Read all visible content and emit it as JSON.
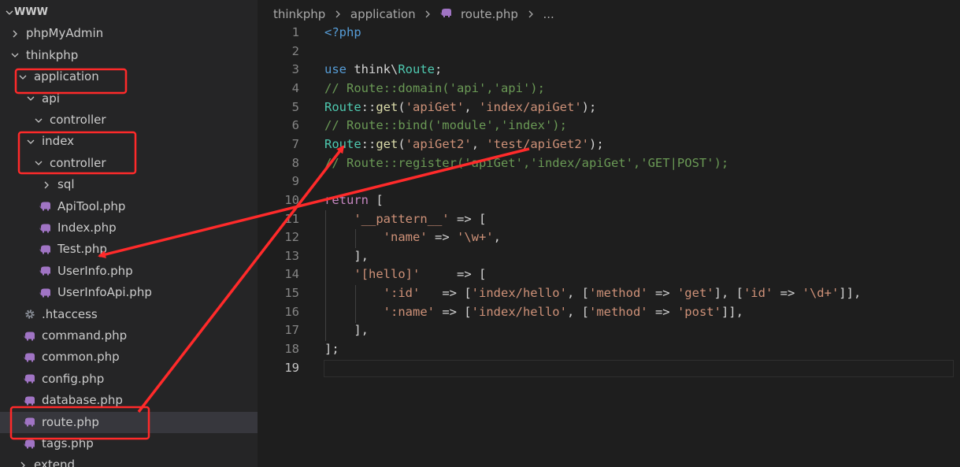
{
  "explorer": {
    "rows": [
      {
        "label": "WWW",
        "depth": 0,
        "chevron": "down",
        "icon": "",
        "root": true
      },
      {
        "label": "phpMyAdmin",
        "depth": 1,
        "chevron": "right",
        "icon": ""
      },
      {
        "label": "thinkphp",
        "depth": 1,
        "chevron": "down",
        "icon": ""
      },
      {
        "label": "application",
        "depth": 2,
        "chevron": "down",
        "icon": ""
      },
      {
        "label": "api",
        "depth": 3,
        "chevron": "down",
        "icon": ""
      },
      {
        "label": "controller",
        "depth": 4,
        "chevron": "down",
        "icon": ""
      },
      {
        "label": "index",
        "depth": 3,
        "chevron": "down",
        "icon": ""
      },
      {
        "label": "controller",
        "depth": 4,
        "chevron": "down",
        "icon": ""
      },
      {
        "label": "sql",
        "depth": 5,
        "chevron": "right",
        "icon": ""
      },
      {
        "label": "ApiTool.php",
        "depth": 5,
        "chevron": "",
        "icon": "php-elephant-icon"
      },
      {
        "label": "Index.php",
        "depth": 5,
        "chevron": "",
        "icon": "php-elephant-icon"
      },
      {
        "label": "Test.php",
        "depth": 5,
        "chevron": "",
        "icon": "php-elephant-icon"
      },
      {
        "label": "UserInfo.php",
        "depth": 5,
        "chevron": "",
        "icon": "php-elephant-icon"
      },
      {
        "label": "UserInfoApi.php",
        "depth": 5,
        "chevron": "",
        "icon": "php-elephant-icon"
      },
      {
        "label": ".htaccess",
        "depth": 3,
        "chevron": "",
        "icon": "gear-icon"
      },
      {
        "label": "command.php",
        "depth": 3,
        "chevron": "",
        "icon": "php-elephant-icon"
      },
      {
        "label": "common.php",
        "depth": 3,
        "chevron": "",
        "icon": "php-elephant-icon"
      },
      {
        "label": "config.php",
        "depth": 3,
        "chevron": "",
        "icon": "php-elephant-icon"
      },
      {
        "label": "database.php",
        "depth": 3,
        "chevron": "",
        "icon": "php-elephant-icon"
      },
      {
        "label": "route.php",
        "depth": 3,
        "chevron": "",
        "icon": "php-elephant-icon",
        "selected": true
      },
      {
        "label": "tags.php",
        "depth": 3,
        "chevron": "",
        "icon": "php-elephant-icon"
      },
      {
        "label": "extend",
        "depth": 2,
        "chevron": "right",
        "icon": ""
      }
    ]
  },
  "breadcrumb": {
    "items": [
      "thinkphp",
      "application",
      "route.php",
      "..."
    ],
    "file_icon": "php-elephant-icon"
  },
  "editor": {
    "active_line": 19,
    "lines": [
      {
        "n": "1",
        "tokens": [
          [
            "tag",
            "<?php"
          ]
        ]
      },
      {
        "n": "2",
        "tokens": []
      },
      {
        "n": "3",
        "tokens": [
          [
            "kw",
            "use"
          ],
          [
            "plain",
            " think\\"
          ],
          [
            "cls",
            "Route"
          ],
          [
            "plain",
            ";"
          ]
        ]
      },
      {
        "n": "4",
        "tokens": [
          [
            "cmt",
            "// Route::domain('api','api');"
          ]
        ]
      },
      {
        "n": "5",
        "tokens": [
          [
            "cls",
            "Route"
          ],
          [
            "plain",
            "::"
          ],
          [
            "fn",
            "get"
          ],
          [
            "plain",
            "("
          ],
          [
            "str",
            "'apiGet'"
          ],
          [
            "plain",
            ", "
          ],
          [
            "str",
            "'index/apiGet'"
          ],
          [
            "plain",
            ");"
          ]
        ]
      },
      {
        "n": "6",
        "tokens": [
          [
            "cmt",
            "// Route::bind('module','index');"
          ]
        ]
      },
      {
        "n": "7",
        "tokens": [
          [
            "cls",
            "Route"
          ],
          [
            "plain",
            "::"
          ],
          [
            "fn",
            "get"
          ],
          [
            "plain",
            "("
          ],
          [
            "str",
            "'apiGet2'"
          ],
          [
            "plain",
            ", "
          ],
          [
            "str",
            "'test/apiGet2'"
          ],
          [
            "plain",
            ");"
          ]
        ]
      },
      {
        "n": "8",
        "tokens": [
          [
            "cmt",
            "// Route::register('apiGet','index/apiGet','GET|POST');"
          ]
        ]
      },
      {
        "n": "9",
        "tokens": []
      },
      {
        "n": "10",
        "tokens": [
          [
            "ctrl",
            "return"
          ],
          [
            "plain",
            " ["
          ]
        ]
      },
      {
        "n": "11",
        "tokens": [
          [
            "plain",
            "    "
          ],
          [
            "str",
            "'__pattern__'"
          ],
          [
            "plain",
            " => ["
          ]
        ]
      },
      {
        "n": "12",
        "tokens": [
          [
            "plain",
            "        "
          ],
          [
            "str",
            "'name'"
          ],
          [
            "plain",
            " => "
          ],
          [
            "str",
            "'\\w+'"
          ],
          [
            "plain",
            ","
          ]
        ]
      },
      {
        "n": "13",
        "tokens": [
          [
            "plain",
            "    ],"
          ]
        ]
      },
      {
        "n": "14",
        "tokens": [
          [
            "plain",
            "    "
          ],
          [
            "str",
            "'[hello]'"
          ],
          [
            "plain",
            "     => ["
          ]
        ]
      },
      {
        "n": "15",
        "tokens": [
          [
            "plain",
            "        "
          ],
          [
            "str",
            "':id'"
          ],
          [
            "plain",
            "   => ["
          ],
          [
            "str",
            "'index/hello'"
          ],
          [
            "plain",
            ", ["
          ],
          [
            "str",
            "'method'"
          ],
          [
            "plain",
            " => "
          ],
          [
            "str",
            "'get'"
          ],
          [
            "plain",
            "], ["
          ],
          [
            "str",
            "'id'"
          ],
          [
            "plain",
            " => "
          ],
          [
            "str",
            "'\\d+'"
          ],
          [
            "plain",
            "]],"
          ]
        ]
      },
      {
        "n": "16",
        "tokens": [
          [
            "plain",
            "        "
          ],
          [
            "str",
            "':name'"
          ],
          [
            "plain",
            " => ["
          ],
          [
            "str",
            "'index/hello'"
          ],
          [
            "plain",
            ", ["
          ],
          [
            "str",
            "'method'"
          ],
          [
            "plain",
            " => "
          ],
          [
            "str",
            "'post'"
          ],
          [
            "plain",
            "]],"
          ]
        ]
      },
      {
        "n": "17",
        "tokens": [
          [
            "plain",
            "    ],"
          ]
        ]
      },
      {
        "n": "18",
        "tokens": [
          [
            "plain",
            "];"
          ]
        ]
      },
      {
        "n": "19",
        "tokens": []
      }
    ]
  },
  "colors": {
    "annotation": "#ff2a2a",
    "php_icon": "#a074c4",
    "gear_icon": "#8a8f98"
  }
}
